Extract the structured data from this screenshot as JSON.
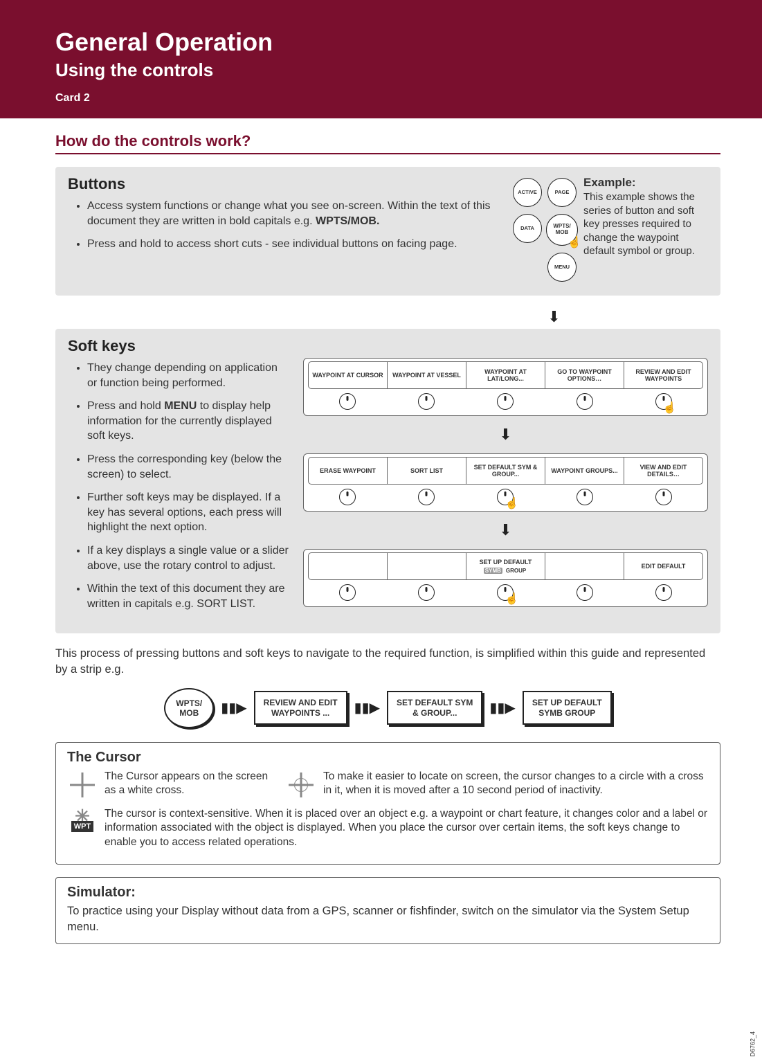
{
  "header": {
    "title": "General Operation",
    "subtitle": "Using the controls",
    "card": "Card 2"
  },
  "question": "How do the controls work?",
  "buttons_section": {
    "heading": "Buttons",
    "bullet1_pre": "Access system functions or change what you see on-screen. Within the text of this document they are written in bold capitals e.g. ",
    "bullet1_bold": "WPTS/MOB.",
    "bullet2": "Press and hold to access short cuts - see individual buttons on facing page.",
    "hardware_buttons": {
      "page": "PAGE",
      "active": "ACTIVE",
      "wpts": "WPTS/\nMOB",
      "data": "DATA",
      "menu": "MENU"
    },
    "example": {
      "heading": "Example:",
      "text": "This example shows the series of button and soft key presses required to change the waypoint default symbol or group."
    }
  },
  "softkeys_section": {
    "heading": "Soft keys",
    "bullets": [
      "They change depending on application or function being performed.",
      "Press and hold MENU to display help information for the currently displayed soft keys.",
      "Press the corresponding key (below the screen) to select.",
      "Further soft keys may be displayed. If a key has several options, each press will highlight the next option.",
      "If a key displays a single value or a slider above, use the rotary control to adjust.",
      "Within the text of this document they are written in capitals e.g. SORT LIST."
    ],
    "bullet2_bold": "MENU",
    "rows": [
      [
        "WAYPOINT AT CURSOR",
        "WAYPOINT AT VESSEL",
        "WAYPOINT AT LAT/LONG...",
        "GO TO WAYPOINT OPTIONS…",
        "REVIEW AND EDIT WAYPOINTS"
      ],
      [
        "ERASE WAYPOINT",
        "SORT LIST",
        "SET DEFAULT SYM & GROUP...",
        "WAYPOINT GROUPS...",
        "VIEW AND EDIT DETAILS…"
      ],
      [
        "",
        "",
        {
          "label": "SET UP DEFAULT",
          "opts": [
            "SYMB",
            "GROUP"
          ],
          "selected": 0
        },
        "",
        "EDIT DEFAULT"
      ]
    ]
  },
  "strip_text": "This process of pressing buttons and soft keys to navigate to the required function, is simplified within this guide and represented by a strip e.g.",
  "strip": {
    "btn": "WPTS/\nMOB",
    "boxes": [
      "REVIEW AND EDIT\nWAYPOINTS ...",
      "SET DEFAULT SYM\n& GROUP...",
      "SET UP DEFAULT\nSYMB   GROUP"
    ]
  },
  "cursor_section": {
    "heading": "The Cursor",
    "c1": "The Cursor appears on the screen as a white cross.",
    "c2": "To make it easier to locate on screen, the cursor changes to a circle with a cross in it, when it is moved after a 10 second period of inactivity.",
    "c3": "The cursor is context-sensitive.  When it is placed over an object e.g. a waypoint or chart feature, it changes color and a label or information associated with the object is displayed.  When you place the cursor over certain items, the soft keys change to enable you to access related operations.",
    "wpt_label": "WPT"
  },
  "simulator_section": {
    "heading": "Simulator:",
    "text": "To practice using your Display without data from a GPS, scanner or fishfinder, switch on the simulator via the System Setup menu."
  },
  "side_ref": "D6762_4"
}
